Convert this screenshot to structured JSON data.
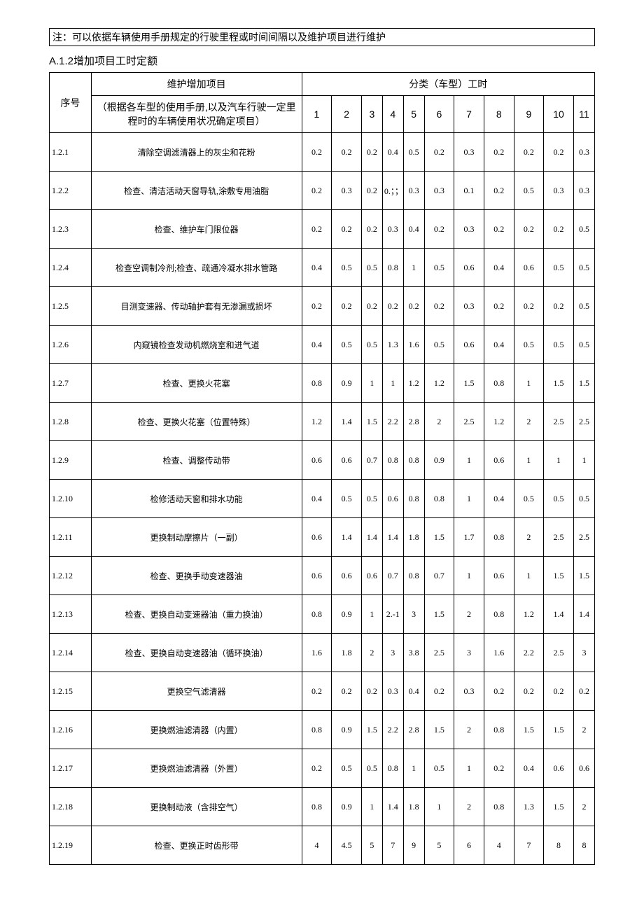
{
  "note": "注：可以依据车辆使用手册规定的行驶里程或时间间隔以及维护项目进行维护",
  "section_title": "A.1.2增加项目工时定额",
  "header": {
    "seq": "序号",
    "desc_line1": "维护增加项目",
    "desc_line2": "（根据各车型的使用手册,以及汽车行驶一定里程时的车辆使用状况确定项目）",
    "group": "分类（车型）工时",
    "cols": [
      "1",
      "2",
      "3",
      "4",
      "5",
      "6",
      "7",
      "8",
      "9",
      "10",
      "11"
    ]
  },
  "chart_data": {
    "type": "table",
    "columns": [
      "序号",
      "维护增加项目",
      "1",
      "2",
      "3",
      "4",
      "5",
      "6",
      "7",
      "8",
      "9",
      "10",
      "11"
    ],
    "rows": [
      [
        "1.2.1",
        "清除空调滤清器上的灰尘和花粉",
        "0.2",
        "0.2",
        "0.2",
        "0.4",
        "0.5",
        "0.2",
        "0.3",
        "0.2",
        "0.2",
        "0.2",
        "0.3"
      ],
      [
        "1.2.2",
        "检查、清洁活动天窗导轨,涂敷专用油脂",
        "0.2",
        "0.3",
        "0.2",
        "0.；；",
        "0.3",
        "0.3",
        "0.1",
        "0.2",
        "0.5",
        "0.3",
        "0.3"
      ],
      [
        "1.2.3",
        "检查、维护车门限位器",
        "0.2",
        "0.2",
        "0.2",
        "0.3",
        "0.4",
        "0.2",
        "0.3",
        "0.2",
        "0.2",
        "0.2",
        "0.5"
      ],
      [
        "1.2.4",
        "检查空调制冷剂;检查、疏通冷凝水排水管路",
        "0.4",
        "0.5",
        "0.5",
        "0.8",
        "1",
        "0.5",
        "0.6",
        "0.4",
        "0.6",
        "0.5",
        "0.5"
      ],
      [
        "1.2.5",
        "目测变速器、传动轴护套有无渗漏或损坏",
        "0.2",
        "0.2",
        "0.2",
        "0.2",
        "0.2",
        "0.2",
        "0.3",
        "0.2",
        "0.2",
        "0.2",
        "0.5"
      ],
      [
        "1.2.6",
        "内窥镜检查发动机燃烧室和进气道",
        "0.4",
        "0.5",
        "0.5",
        "1.3",
        "1.6",
        "0.5",
        "0.6",
        "0.4",
        "0.5",
        "0.5",
        "0.5"
      ],
      [
        "1.2.7",
        "检查、更换火花塞",
        "0.8",
        "0.9",
        "1",
        "1",
        "1.2",
        "1.2",
        "1.5",
        "0.8",
        "1",
        "1.5",
        "1.5"
      ],
      [
        "1.2.8",
        "检查、更换火花塞（位置特殊）",
        "1.2",
        "1.4",
        "1.5",
        "2.2",
        "2.8",
        "2",
        "2.5",
        "1.2",
        "2",
        "2.5",
        "2.5"
      ],
      [
        "1.2.9",
        "检查、调整传动带",
        "0.6",
        "0.6",
        "0.7",
        "0.8",
        "0.8",
        "0.9",
        "1",
        "0.6",
        "1",
        "1",
        "1"
      ],
      [
        "1.2.10",
        "检修活动天窗和排水功能",
        "0.4",
        "0.5",
        "0.5",
        "0.6",
        "0.8",
        "0.8",
        "1",
        "0.4",
        "0.5",
        "0.5",
        "0.5"
      ],
      [
        "1.2.11",
        "更换制动摩擦片（一副）",
        "0.6",
        "1.4",
        "1.4",
        "1.4",
        "1.8",
        "1.5",
        "1.7",
        "0.8",
        "2",
        "2.5",
        "2.5"
      ],
      [
        "1.2.12",
        "检查、更换手动变速器油",
        "0.6",
        "0.6",
        "0.6",
        "0.7",
        "0.8",
        "0.7",
        "1",
        "0.6",
        "1",
        "1.5",
        "1.5"
      ],
      [
        "1.2.13",
        "检查、更换自动变速器油（重力换油）",
        "0.8",
        "0.9",
        "1",
        "2.-1",
        "3",
        "1.5",
        "2",
        "0.8",
        "1.2",
        "1.4",
        "1.4"
      ],
      [
        "1.2.14",
        "检查、更换自动变速器油（循环换油）",
        "1.6",
        "1.8",
        "2",
        "3",
        "3.8",
        "2.5",
        "3",
        "1.6",
        "2.2",
        "2.5",
        "3"
      ],
      [
        "1.2.15",
        "更换空气滤清器",
        "0.2",
        "0.2",
        "0.2",
        "0.3",
        "0.4",
        "0.2",
        "0.3",
        "0.2",
        "0.2",
        "0.2",
        "0.2"
      ],
      [
        "1.2.16",
        "更换燃油滤清器（内置）",
        "0.8",
        "0.9",
        "1.5",
        "2.2",
        "2.8",
        "1.5",
        "2",
        "0.8",
        "1.5",
        "1.5",
        "2"
      ],
      [
        "1.2.17",
        "更换燃油滤清器（外置）",
        "0.2",
        "0.5",
        "0.5",
        "0.8",
        "1",
        "0.5",
        "1",
        "0.2",
        "0.4",
        "0.6",
        "0.6"
      ],
      [
        "1.2.18",
        "更换制动液（含排空气）",
        "0.8",
        "0.9",
        "1",
        "1.4",
        "1.8",
        "1",
        "2",
        "0.8",
        "1.3",
        "1.5",
        "2"
      ],
      [
        "1.2.19",
        "检查、更换正时齿形带",
        "4",
        "4.5",
        "5",
        "7",
        "9",
        "5",
        "6",
        "4",
        "7",
        "8",
        "8"
      ]
    ]
  }
}
